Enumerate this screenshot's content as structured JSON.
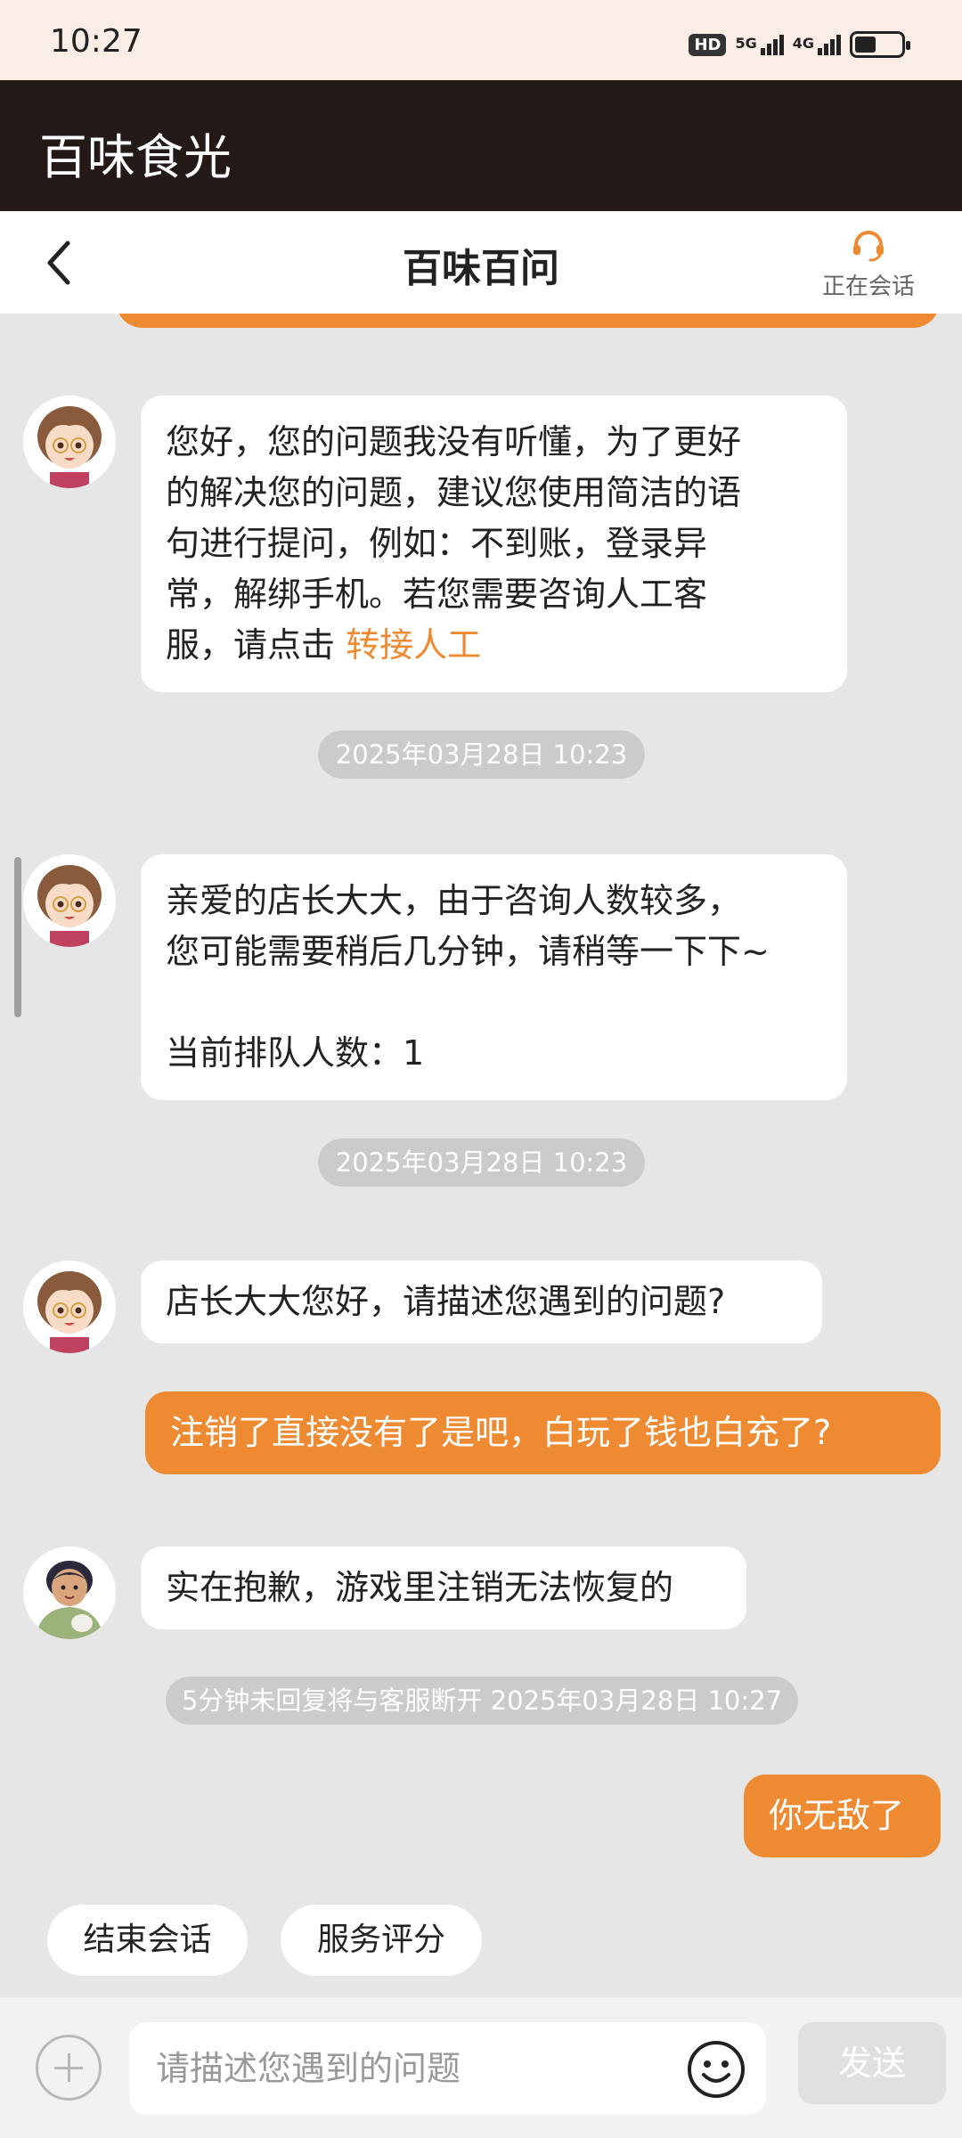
{
  "status_bar": {
    "time": "10:27",
    "hd_badge": "HD",
    "network_1": "5G",
    "network_2": "4G",
    "battery_level": 0.45
  },
  "app_bar": {
    "title": "百味食光"
  },
  "chat_header": {
    "title": "百味百问",
    "agent_status": "正在会话",
    "back_icon": "chevron-left-icon",
    "agent_icon": "headset-icon"
  },
  "messages": [
    {
      "sender": "bot",
      "lines": [
        "您好，您的问题我没有听懂，为了更好",
        "的解决您的问题，建议您使用简洁的语",
        "句进行提问，例如：不到账，登录异",
        "常，解绑手机。若您需要咨询人工客"
      ],
      "last_line_prefix": "服，请点击 ",
      "link_text": "转接人工"
    },
    {
      "timestamp": "2025年03月28日 10:23"
    },
    {
      "sender": "bot",
      "lines": [
        "亲爱的店长大大，由于咨询人数较多，",
        "您可能需要稍后几分钟，请稍等一下下~"
      ],
      "queue_line": "当前排队人数：1"
    },
    {
      "timestamp": "2025年03月28日 10:23"
    },
    {
      "sender": "bot",
      "text": "店长大大您好，请描述您遇到的问题?"
    },
    {
      "sender": "user",
      "text": "注销了直接没有了是吧，白玩了钱也白充了?"
    },
    {
      "sender": "agent",
      "text": "实在抱歉，游戏里注销无法恢复的"
    },
    {
      "timestamp": "5分钟未回复将与客服断开 2025年03月28日 10:27"
    },
    {
      "sender": "user",
      "text": "你无敌了"
    }
  ],
  "quick_actions": [
    {
      "label": "结束会话"
    },
    {
      "label": "服务评分"
    }
  ],
  "input_bar": {
    "placeholder": "请描述您遇到的问题",
    "send_label": "发送",
    "add_icon": "plus-circle-icon",
    "emoji_icon": "smiley-icon"
  },
  "colors": {
    "accent": "#ee8a32",
    "app_bar": "#231a18",
    "status_bar": "#f9ede6",
    "chat_bg": "#e6e6e6"
  }
}
